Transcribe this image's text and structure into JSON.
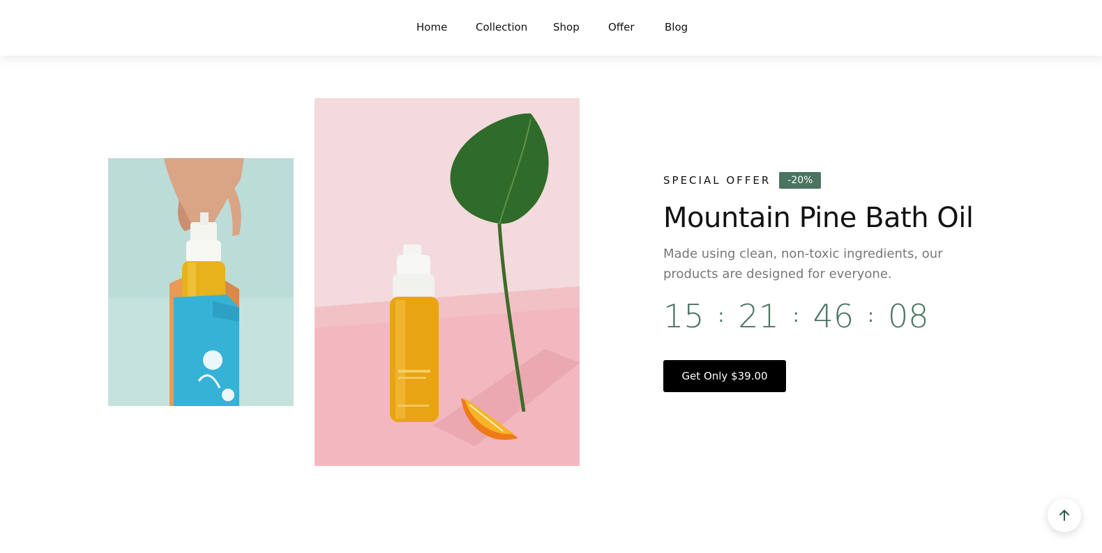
{
  "nav": {
    "items": [
      {
        "label": "Home"
      },
      {
        "label": "Collection"
      },
      {
        "label": "Shop"
      },
      {
        "label": "Offer"
      },
      {
        "label": "Blog"
      }
    ]
  },
  "offer": {
    "label": "SPECIAL OFFER",
    "discount": "-20%",
    "title": "Mountain Pine Bath Oil",
    "description": "Made using clean, non-toxic ingredients, our products are designed for everyone.",
    "countdown": {
      "days": "15",
      "hours": "21",
      "minutes": "46",
      "seconds": "08",
      "separator": ":"
    },
    "cta_label": "Get Only $39.00"
  },
  "colors": {
    "accent": "#4a7360",
    "cta_bg": "#000000"
  },
  "icons": {
    "back_to_top": "arrow-up-icon"
  }
}
